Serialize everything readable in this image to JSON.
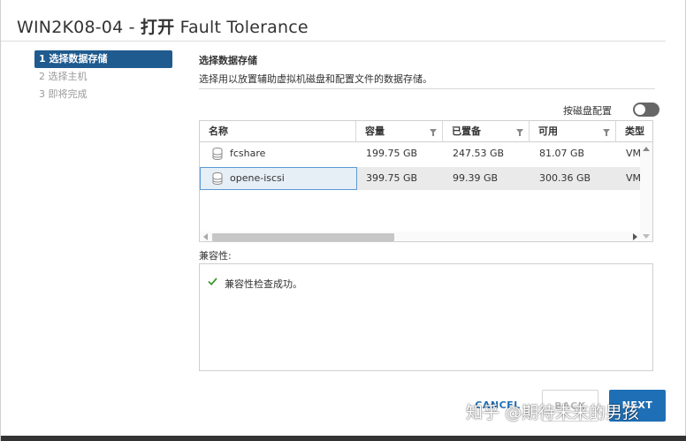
{
  "window": {
    "vm_name": "WIN2K08-04",
    "separator": " - ",
    "action": "打开",
    "feature": " Fault Tolerance"
  },
  "steps": [
    {
      "label": "1 选择数据存储",
      "active": true
    },
    {
      "label": "2 选择主机",
      "active": false
    },
    {
      "label": "3 即将完成",
      "active": false
    }
  ],
  "section": {
    "title": "选择数据存储",
    "description": "选择用以放置辅助虚拟机磁盘和配置文件的数据存储。"
  },
  "toggle": {
    "label": "按磁盘配置",
    "on": false
  },
  "table": {
    "columns": [
      "名称",
      "容量",
      "已置备",
      "可用",
      "类型"
    ],
    "rows": [
      {
        "name": "fcshare",
        "capacity": "199.75 GB",
        "provisioned": "247.53 GB",
        "free": "81.07 GB",
        "type": "VM",
        "selected": false
      },
      {
        "name": "opene-iscsi",
        "capacity": "399.75 GB",
        "provisioned": "99.39 GB",
        "free": "300.36 GB",
        "type": "VM",
        "selected": true
      }
    ]
  },
  "compatibility": {
    "label": "兼容性:",
    "message": "兼容性检查成功。"
  },
  "buttons": {
    "cancel": "CANCEL",
    "back": "BACK",
    "next": "NEXT"
  },
  "watermark": "知乎 @期待未来的男孩",
  "colors": {
    "accent": "#1f6fb6",
    "active_step": "#1f5b8e",
    "success": "#3c9a2b"
  },
  "icons": {
    "datastore": "datastore-icon",
    "filter": "filter-icon",
    "check": "check-icon"
  }
}
